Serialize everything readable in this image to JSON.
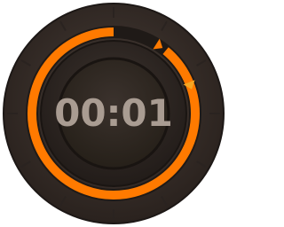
{
  "timer": {
    "display": "00:01",
    "progress_fraction": 0.89,
    "lap_marker_fractions": [
      0.09,
      0.19
    ]
  },
  "colors": {
    "accent": "#ff7a00",
    "bezel": "#3a302b",
    "face": "#2e2622",
    "digits": "#a99c92",
    "marker": "#f5a623"
  },
  "icons": {
    "lap_marker": "triangle-marker-icon"
  }
}
